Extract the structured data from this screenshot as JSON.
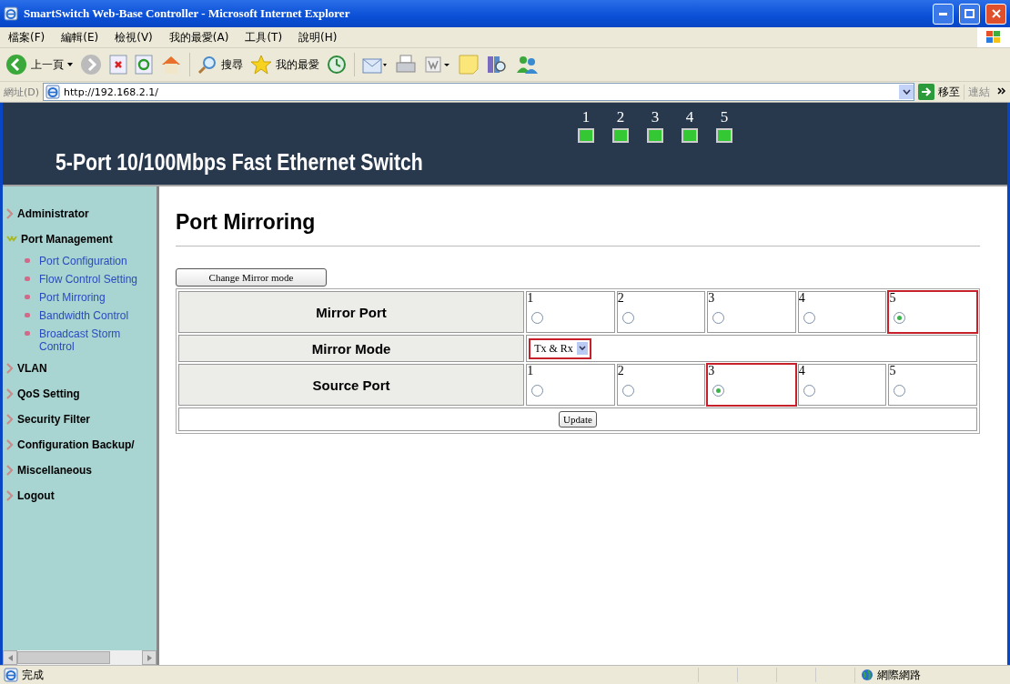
{
  "window": {
    "title": "SmartSwitch Web-Base Controller - Microsoft Internet Explorer"
  },
  "menu": [
    "檔案(F)",
    "編輯(E)",
    "檢視(V)",
    "我的最愛(A)",
    "工具(T)",
    "說明(H)"
  ],
  "toolbar": {
    "back_label": "上一頁",
    "search_label": "搜尋",
    "favorites_label": "我的最愛"
  },
  "address_bar": {
    "label": "網址(D)",
    "value": "http://192.168.2.1/",
    "go_label": "移至",
    "links_label": "連結"
  },
  "header": {
    "title": "5-Port 10/100Mbps Fast Ethernet Switch",
    "ports": [
      {
        "label": "1"
      },
      {
        "label": "2"
      },
      {
        "label": "3"
      },
      {
        "label": "4"
      },
      {
        "label": "5"
      }
    ]
  },
  "sidebar": {
    "items": [
      {
        "label": "Administrator",
        "expanded": false
      },
      {
        "label": "Port Management",
        "expanded": true,
        "children": [
          {
            "label": "Port Configuration"
          },
          {
            "label": "Flow Control Setting"
          },
          {
            "label": "Port Mirroring"
          },
          {
            "label": "Bandwidth Control"
          },
          {
            "label": "Broadcast Storm Control"
          }
        ]
      },
      {
        "label": "VLAN",
        "expanded": false
      },
      {
        "label": "QoS Setting",
        "expanded": false
      },
      {
        "label": "Security Filter",
        "expanded": false
      },
      {
        "label": "Configuration Backup/",
        "expanded": false
      },
      {
        "label": "Miscellaneous",
        "expanded": false
      },
      {
        "label": "Logout",
        "expanded": false
      }
    ]
  },
  "content": {
    "heading": "Port Mirroring",
    "change_button": "Change Mirror mode",
    "rows": [
      {
        "kind": "ports",
        "label": "Mirror Port",
        "ports": [
          {
            "label": "1",
            "selected": false
          },
          {
            "label": "2",
            "selected": false
          },
          {
            "label": "3",
            "selected": false
          },
          {
            "label": "4",
            "selected": false
          },
          {
            "label": "5",
            "selected": true
          }
        ]
      },
      {
        "kind": "select",
        "label": "Mirror Mode",
        "value": "Tx & Rx",
        "highlighted": true
      },
      {
        "kind": "ports",
        "label": "Source Port",
        "ports": [
          {
            "label": "1",
            "selected": false
          },
          {
            "label": "2",
            "selected": false
          },
          {
            "label": "3",
            "selected": true
          },
          {
            "label": "4",
            "selected": false
          },
          {
            "label": "5",
            "selected": false
          }
        ]
      },
      {
        "kind": "button",
        "label": "Update"
      }
    ]
  },
  "status_bar": {
    "text": "完成",
    "zone": "網際網路"
  }
}
